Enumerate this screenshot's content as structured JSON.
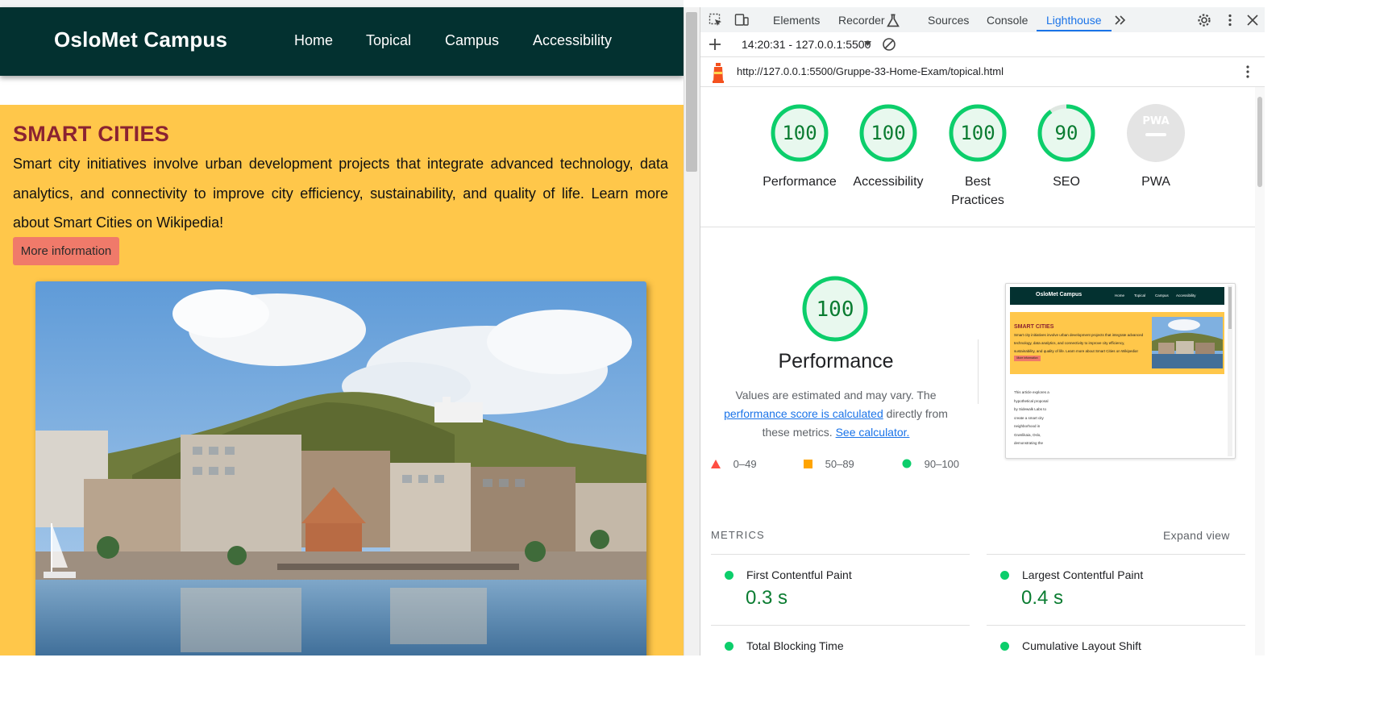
{
  "site": {
    "brand": "OsloMet Campus",
    "nav": [
      "Home",
      "Topical",
      "Campus",
      "Accessibility"
    ],
    "hero_title": "SMART CITIES",
    "hero_text": "Smart city initiatives involve urban development projects that integrate advanced technology, data analytics, and connectivity to improve city efficiency, sustainability, and quality of life. Learn more about Smart Cities on Wikipedia!",
    "more_button": "More information"
  },
  "devtools": {
    "tabs": [
      "Elements",
      "Recorder",
      "Sources",
      "Console",
      "Lighthouse"
    ],
    "active_tab": "Lighthouse",
    "report_selector": "14:20:31 - 127.0.0.1:5500",
    "url": "http://127.0.0.1:5500/Gruppe-33-Home-Exam/topical.html"
  },
  "scores": [
    {
      "label": "Performance",
      "value": "100",
      "fraction": 1.0
    },
    {
      "label": "Accessibility",
      "value": "100",
      "fraction": 1.0
    },
    {
      "label": "Best Practices",
      "value": "100",
      "fraction": 1.0
    },
    {
      "label": "SEO",
      "value": "90",
      "fraction": 0.9
    },
    {
      "label": "PWA",
      "value": "PWA",
      "fraction": 0
    }
  ],
  "performance": {
    "score": "100",
    "title": "Performance",
    "desc_1": "Values are estimated and may vary. The",
    "desc_link1": "performance score is calculated",
    "desc_2": "directly from these metrics.",
    "desc_link2": "See calculator.",
    "legend": [
      "0–49",
      "50–89",
      "90–100"
    ]
  },
  "thumbnail": {
    "brand": "OsloMet Campus",
    "nav": [
      "Home",
      "Topical",
      "Campus",
      "Accessibility"
    ],
    "title": "SMART CITIES",
    "text": "Smart city initiatives involve urban development projects that integrate advanced technology, data analytics, and connectivity to improve city efficiency, sustainability, and quality of life. Learn more about Smart Cities on Wikipedia!",
    "button": "More information",
    "body_text": "This article explores a hypothetical proposal by Sidewalk Labs to create a smart city neighborhood in Grønlikaia, Oslo, demonstrating the"
  },
  "metrics": {
    "heading": "METRICS",
    "expand": "Expand view",
    "items": [
      {
        "name": "First Contentful Paint",
        "value": "0.3 s"
      },
      {
        "name": "Largest Contentful Paint",
        "value": "0.4 s"
      },
      {
        "name": "Total Blocking Time",
        "value": ""
      },
      {
        "name": "Cumulative Layout Shift",
        "value": ""
      }
    ]
  },
  "colors": {
    "pass": "#0cce6b",
    "average": "#ffa400",
    "fail": "#ff4e42",
    "navbar": "#033130",
    "hero": "#ffc74a"
  }
}
